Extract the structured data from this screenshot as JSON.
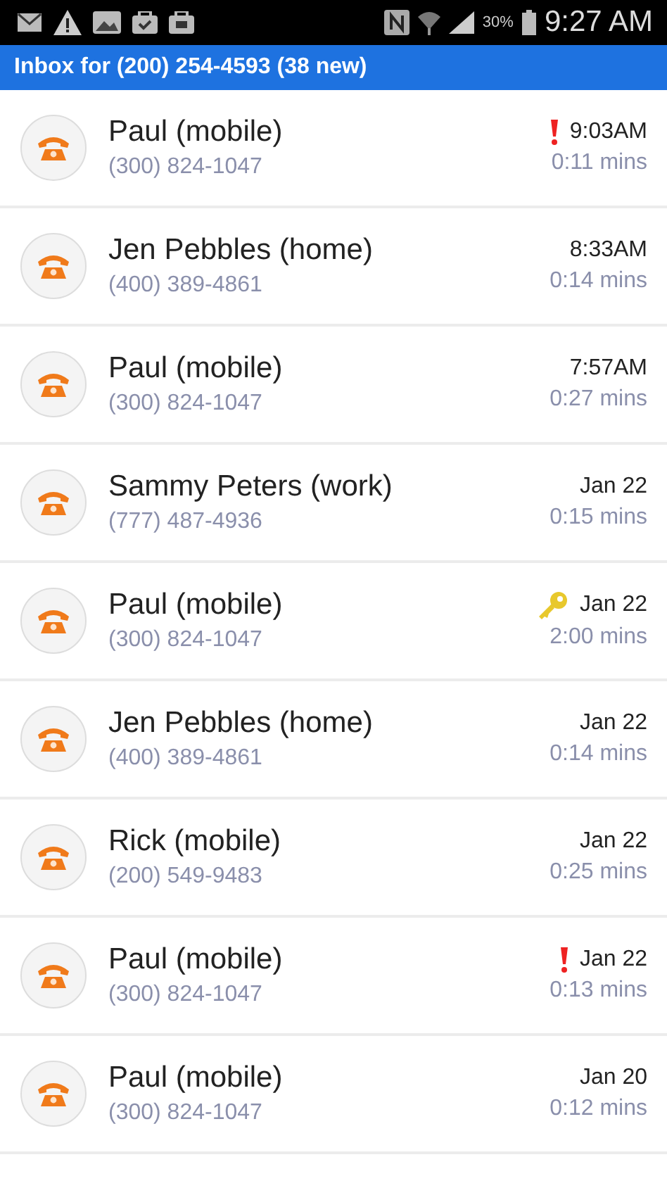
{
  "status_bar": {
    "battery_text": "30%",
    "time": "9:27 AM"
  },
  "header": {
    "prefix": "Inbox for",
    "number": "(200) 254-4593",
    "count": "(38 new)"
  },
  "calls": [
    {
      "name": "Paul (mobile)",
      "phone": "(300) 824-1047",
      "time": "9:03AM",
      "duration": "0:11 mins",
      "urgent": true,
      "key": false
    },
    {
      "name": "Jen Pebbles (home)",
      "phone": "(400) 389-4861",
      "time": "8:33AM",
      "duration": "0:14 mins",
      "urgent": false,
      "key": false
    },
    {
      "name": "Paul (mobile)",
      "phone": "(300) 824-1047",
      "time": "7:57AM",
      "duration": "0:27 mins",
      "urgent": false,
      "key": false
    },
    {
      "name": "Sammy Peters (work)",
      "phone": "(777) 487-4936",
      "time": "Jan 22",
      "duration": "0:15 mins",
      "urgent": false,
      "key": false
    },
    {
      "name": "Paul (mobile)",
      "phone": "(300) 824-1047",
      "time": "Jan 22",
      "duration": "2:00 mins",
      "urgent": false,
      "key": true
    },
    {
      "name": "Jen Pebbles (home)",
      "phone": "(400) 389-4861",
      "time": "Jan 22",
      "duration": "0:14 mins",
      "urgent": false,
      "key": false
    },
    {
      "name": "Rick (mobile)",
      "phone": "(200) 549-9483",
      "time": "Jan 22",
      "duration": "0:25 mins",
      "urgent": false,
      "key": false
    },
    {
      "name": "Paul (mobile)",
      "phone": "(300) 824-1047",
      "time": "Jan 22",
      "duration": "0:13 mins",
      "urgent": true,
      "key": false
    },
    {
      "name": "Paul (mobile)",
      "phone": "(300) 824-1047",
      "time": "Jan 20",
      "duration": "0:12 mins",
      "urgent": false,
      "key": false
    }
  ]
}
